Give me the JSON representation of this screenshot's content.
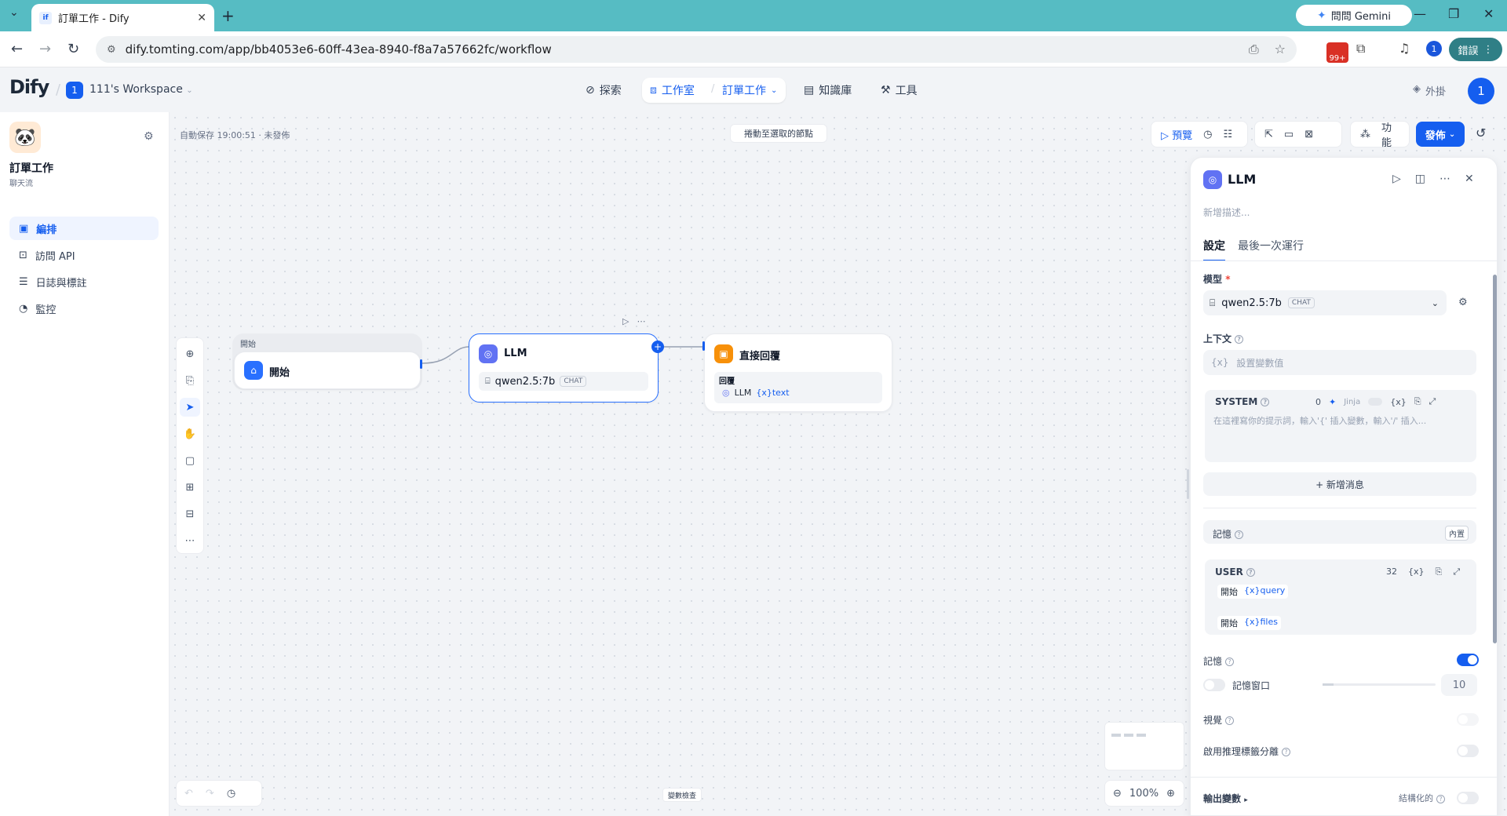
{
  "browser": {
    "tab_title": "訂單工作 - Dify",
    "url": "dify.tomting.com/app/bb4053e6-60ff-43ea-8940-f8a7a57662fc/workflow",
    "gemini_label": "問問 Gemini",
    "error_label": "錯誤",
    "ext_badge": "99+",
    "profile_initial": "1"
  },
  "header": {
    "logo": "Dify",
    "workspace_initial": "1",
    "workspace_name": "111's Workspace",
    "nav": {
      "explore": "探索",
      "studio": "工作室",
      "current_app": "訂單工作",
      "knowledge": "知識庫",
      "tools": "工具"
    },
    "plugins": "外掛",
    "user_initial": "1"
  },
  "sidebar": {
    "app_name": "訂單工作",
    "app_type": "聊天流",
    "items": [
      {
        "label": "編排",
        "icon": "layout-icon"
      },
      {
        "label": "訪問 API",
        "icon": "terminal-icon"
      },
      {
        "label": "日誌與標註",
        "icon": "file-list-icon"
      },
      {
        "label": "監控",
        "icon": "dashboard-icon"
      }
    ]
  },
  "canvas": {
    "autosave": "自動保存 19:00:51 · 未發佈",
    "drag_tip": "捲動至選取的節點",
    "toolbar": {
      "preview": "預覽",
      "features": "功能",
      "publish": "發佈"
    },
    "start_node": {
      "group_label": "開始",
      "title": "開始"
    },
    "llm_node": {
      "title": "LLM",
      "model": "qwen2.5:7b",
      "mode": "CHAT"
    },
    "answer_node": {
      "title": "直接回覆",
      "field_label": "回覆",
      "source": "LLM",
      "var": "{x}text"
    },
    "variable_check": "變數檢查",
    "zoom": "100%"
  },
  "panel": {
    "title": "LLM",
    "desc_placeholder": "新增描述...",
    "tabs": [
      "設定",
      "最後一次運行"
    ],
    "model_label": "模型",
    "model_name": "qwen2.5:7b",
    "model_mode": "CHAT",
    "context_label": "上下文",
    "context_placeholder": "設置變數值",
    "system_label": "SYSTEM",
    "system_count": "0",
    "jinja": "Jinja",
    "system_placeholder": "在這裡寫你的提示詞，輸入'{' 插入變數，輸入'/' 插入...",
    "add_message": "+ 新增消息",
    "memory_label": "記憶",
    "memory_badge": "內置",
    "user_label": "USER",
    "user_count": "32",
    "user_vars": [
      {
        "node": "開始",
        "var": "{x}query"
      },
      {
        "node": "開始",
        "var": "{x}files"
      }
    ],
    "memory_toggle_label": "記憶",
    "memory_on": true,
    "memory_window_label": "記憶窗口",
    "memory_window_value": "10",
    "vision_label": "視覺",
    "reasoning_label": "啟用推理標籤分離",
    "output_label": "輸出變數",
    "structured_label": "結構化的"
  }
}
